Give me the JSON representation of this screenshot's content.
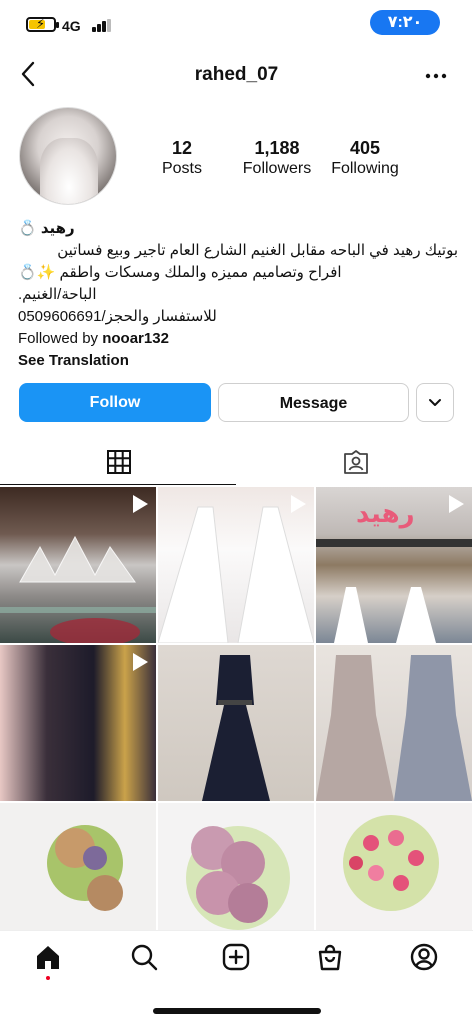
{
  "status_bar": {
    "time": "٧:٢٠",
    "network": "4G"
  },
  "header": {
    "username": "rahed_07",
    "back_icon": "chevron-left-icon",
    "more_icon": "more-horizontal-icon"
  },
  "profile": {
    "stats": [
      {
        "value": "12",
        "label": "Posts"
      },
      {
        "value": "1,188",
        "label": "Followers"
      },
      {
        "value": "405",
        "label": "Following"
      }
    ],
    "name": "رهيد 💍",
    "bio_lines": [
      "بوتيك رهيد في الباحه مقابل الغنيم الشارع العام تاجير وبيع فساتين",
      "افراح وتصاميم مميزه والملك ومسكات واطقم ✨💍",
      "الباحة/الغنيم.",
      "للاستفسار والحجز/0509606691"
    ],
    "followed_by_prefix": "Followed by ",
    "followed_by_user": "nooar132",
    "see_translation": "See Translation"
  },
  "actions": {
    "follow_label": "Follow",
    "message_label": "Message",
    "follow_color": "#1a94f5"
  },
  "tabs": [
    {
      "name": "grid",
      "icon": "grid-icon",
      "active": true
    },
    {
      "name": "tagged",
      "icon": "tagged-person-icon",
      "active": false
    }
  ],
  "posts": [
    {
      "subject": "crown on glass shelf",
      "video": true
    },
    {
      "subject": "white wedding dresses",
      "video": true
    },
    {
      "subject": "boutique storefront",
      "video": true
    },
    {
      "subject": "sequin evening dress",
      "video": true
    },
    {
      "subject": "navy lace gown on mannequin",
      "video": false
    },
    {
      "subject": "embellished gowns",
      "video": false
    },
    {
      "subject": "peach and lilac bouquet",
      "video": false
    },
    {
      "subject": "pink peony bouquet",
      "video": false
    },
    {
      "subject": "pink and white bouquet",
      "video": false
    }
  ],
  "bottom_nav": [
    {
      "name": "home",
      "icon": "home-icon"
    },
    {
      "name": "search",
      "icon": "search-icon"
    },
    {
      "name": "create",
      "icon": "plus-square-icon"
    },
    {
      "name": "shop",
      "icon": "shopping-bag-icon"
    },
    {
      "name": "profile",
      "icon": "profile-icon"
    }
  ]
}
